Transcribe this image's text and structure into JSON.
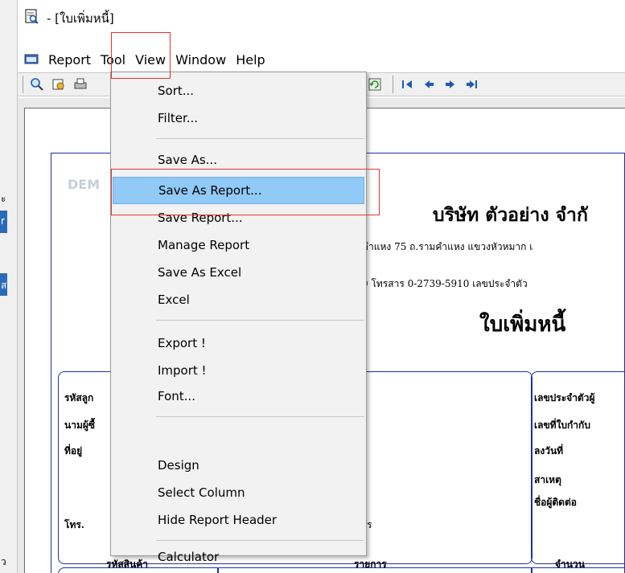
{
  "window": {
    "title": "- [ใบเพิ่มหนี้]"
  },
  "menubar": {
    "items": [
      "Report",
      "Tool",
      "View",
      "Window",
      "Help"
    ]
  },
  "tool_menu": {
    "items": [
      "Sort...",
      "Filter...",
      "Save As...",
      "Save As Report...",
      "Save Report...",
      "Manage Report",
      "Save As Excel",
      "Excel",
      "Export !",
      "Import !",
      "Font...",
      "Design",
      "Select Column",
      "Hide Report Header",
      "Calculator"
    ],
    "highlighted": "Save As Report..."
  },
  "report": {
    "watermark": "DEM",
    "company": "บริษัท ตัวอย่าง จำกั",
    "address_line1": "คำแหง 75 ถ.รามคำแหง แขวงหัวหมาก เ",
    "address_line2": "0   โทรสาร 0-2739-5910   เลขประจำตัว",
    "doc_title": "ใบเพิ่มหนี้",
    "left_labels": [
      "รหัสลูก",
      "นามผู้ซื้",
      "ที่อยู่",
      "โทร."
    ],
    "mid_fragment": "ร",
    "right_labels": [
      "เลขประจำตัวผู้",
      "เลขที่ใบกำกับ",
      "ลงวันที่",
      "สาเหตุ",
      "ชื่อผู้ติดต่อ"
    ],
    "table_headers": [
      "รหัสสินค้า",
      "รายการ",
      "จำนวน"
    ]
  },
  "left_strip": {
    "chars": [
      "ะ",
      "r",
      "ส",
      "ว"
    ]
  },
  "colors": {
    "menu_highlight": "#91c9f7",
    "annotation": "#e8312f",
    "report_border": "#1f2fa8"
  }
}
